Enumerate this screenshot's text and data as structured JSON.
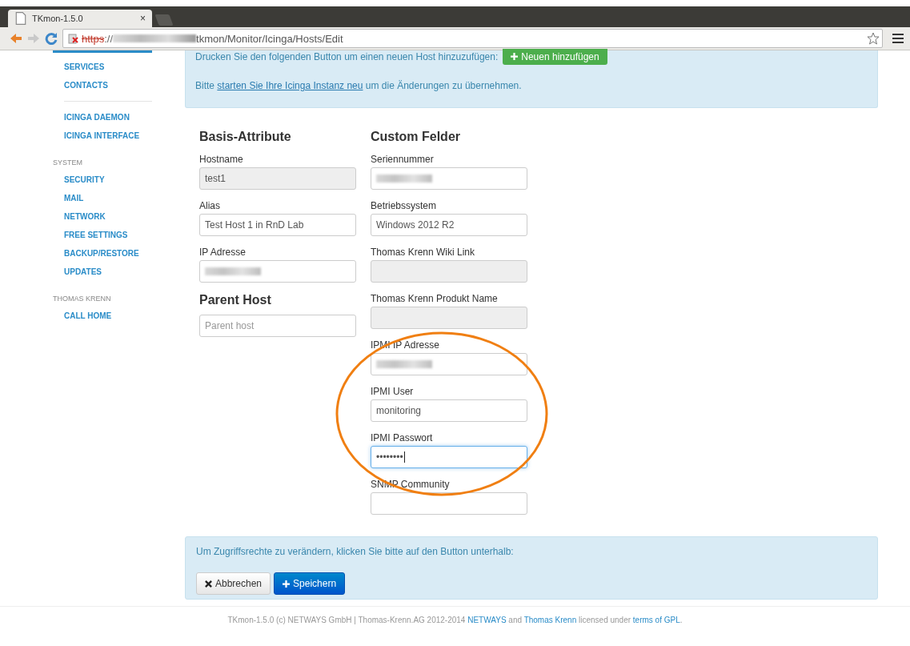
{
  "browser": {
    "tab_title": "TKmon-1.5.0",
    "tab_close": "×",
    "url": {
      "scheme": "https",
      "insecure": true,
      "separator": "://",
      "host_redacted": true,
      "path": "tkmon/Monitor/Icinga/Hosts/Edit"
    }
  },
  "sidebar": {
    "sections": [
      {
        "items": [
          {
            "label": "SERVICES"
          },
          {
            "label": "CONTACTS"
          }
        ]
      },
      {
        "divider": true,
        "items": [
          {
            "label": "ICINGA DAEMON"
          },
          {
            "label": "ICINGA INTERFACE"
          }
        ]
      },
      {
        "title": "SYSTEM",
        "items": [
          {
            "label": "SECURITY"
          },
          {
            "label": "MAIL"
          },
          {
            "label": "NETWORK"
          },
          {
            "label": "FREE SETTINGS"
          },
          {
            "label": "BACKUP/RESTORE"
          },
          {
            "label": "UPDATES"
          }
        ]
      },
      {
        "title": "THOMAS KRENN",
        "items": [
          {
            "label": "CALL HOME"
          }
        ]
      }
    ]
  },
  "info": {
    "text": "Drucken Sie den folgenden Button um einen neuen Host hinzuzufügen:",
    "add_button": "Neuen hinzufügen",
    "restart_before": "Bitte ",
    "restart_link": "starten Sie Ihre Icinga Instanz neu",
    "restart_after": " um die Änderungen zu übernehmen."
  },
  "form": {
    "columns": [
      {
        "blocks": [
          {
            "kind": "heading",
            "text": "Basis-Attribute"
          },
          {
            "kind": "field",
            "label": "Hostname",
            "value": "test1",
            "readonly": true
          },
          {
            "kind": "field",
            "label": "Alias",
            "value": "Test Host 1 in RnD Lab",
            "readonly": false
          },
          {
            "kind": "field",
            "label": "IP Adresse",
            "redacted": true,
            "readonly": false
          },
          {
            "kind": "heading",
            "text": "Parent Host"
          },
          {
            "kind": "field",
            "placeholder": "Parent host",
            "readonly": false
          }
        ]
      },
      {
        "blocks": [
          {
            "kind": "heading",
            "text": "Custom Felder"
          },
          {
            "kind": "field",
            "label": "Seriennummer",
            "redacted": true,
            "readonly": false
          },
          {
            "kind": "field",
            "label": "Betriebssystem",
            "value": "Windows 2012 R2",
            "readonly": false
          },
          {
            "kind": "field",
            "label": "Thomas Krenn Wiki Link",
            "readonly": true
          },
          {
            "kind": "field",
            "label": "Thomas Krenn Produkt Name",
            "readonly": true
          },
          {
            "kind": "field",
            "label": "IPMI IP Adresse",
            "redacted": true,
            "readonly": false
          },
          {
            "kind": "field",
            "label": "IPMI User",
            "value": "monitoring",
            "readonly": false
          },
          {
            "kind": "field",
            "label": "IPMI Passwort",
            "value": "••••••••",
            "readonly": false,
            "focused": true
          },
          {
            "kind": "field",
            "label": "SNMP Community",
            "readonly": false
          }
        ]
      }
    ]
  },
  "actions": {
    "text": "Um Zugriffsrechte zu verändern, klicken Sie bitte auf den Button unterhalb:",
    "buttons": [
      {
        "kind": "cancel",
        "label": "Abbrechen"
      },
      {
        "kind": "save",
        "label": "Speichern"
      }
    ]
  },
  "footer": {
    "segments": [
      {
        "text": "TKmon-1.5.0 (c) NETWAYS GmbH | Thomas-Krenn.AG 2012-2014 ",
        "link": false
      },
      {
        "text": "NETWAYS",
        "link": true
      },
      {
        "text": " and ",
        "link": false
      },
      {
        "text": "Thomas Krenn",
        "link": true
      },
      {
        "text": " licensed under ",
        "link": false
      },
      {
        "text": "terms of GPL",
        "link": true
      },
      {
        "text": ".",
        "link": false
      }
    ]
  },
  "annotation": {
    "kind": "ellipse",
    "color": "#f07f12"
  }
}
